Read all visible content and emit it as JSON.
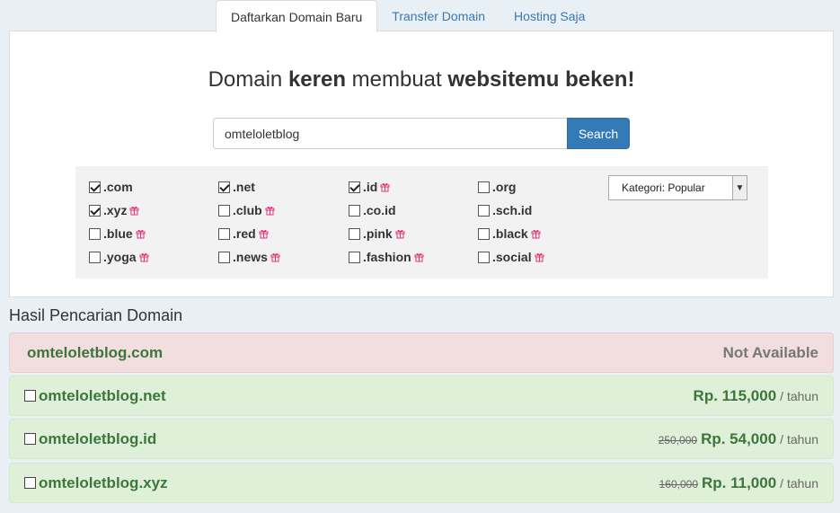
{
  "tabs": [
    {
      "label": "Daftarkan Domain Baru",
      "active": true
    },
    {
      "label": "Transfer Domain",
      "active": false
    },
    {
      "label": "Hosting Saja",
      "active": false
    }
  ],
  "headline": {
    "part1": "Domain ",
    "bold1": "keren",
    "part2": " membuat ",
    "bold2": "websitemu beken!"
  },
  "search": {
    "value": "omteloletblog",
    "button_label": "Search"
  },
  "tlds": [
    {
      "name": ".com",
      "checked": true,
      "gift": false
    },
    {
      "name": ".net",
      "checked": true,
      "gift": false
    },
    {
      "name": ".id",
      "checked": true,
      "gift": true
    },
    {
      "name": ".org",
      "checked": false,
      "gift": false
    },
    {
      "name": ".xyz",
      "checked": true,
      "gift": true
    },
    {
      "name": ".club",
      "checked": false,
      "gift": true
    },
    {
      "name": ".co.id",
      "checked": false,
      "gift": false
    },
    {
      "name": ".sch.id",
      "checked": false,
      "gift": false
    },
    {
      "name": ".blue",
      "checked": false,
      "gift": true
    },
    {
      "name": ".red",
      "checked": false,
      "gift": true
    },
    {
      "name": ".pink",
      "checked": false,
      "gift": true
    },
    {
      "name": ".black",
      "checked": false,
      "gift": true
    },
    {
      "name": ".yoga",
      "checked": false,
      "gift": true
    },
    {
      "name": ".news",
      "checked": false,
      "gift": true
    },
    {
      "name": ".fashion",
      "checked": false,
      "gift": true
    },
    {
      "name": ".social",
      "checked": false,
      "gift": true
    }
  ],
  "kategori": {
    "selected": "Kategori: Popular"
  },
  "results_title": "Hasil Pencarian Domain",
  "results": [
    {
      "domain": "omteloletblog.com",
      "available": false,
      "status": "Not Available"
    },
    {
      "domain": "omteloletblog.net",
      "available": true,
      "old_price": "",
      "price": "Rp. 115,000",
      "per": "/ tahun"
    },
    {
      "domain": "omteloletblog.id",
      "available": true,
      "old_price": "250,000",
      "price": "Rp. 54,000",
      "per": "/ tahun"
    },
    {
      "domain": "omteloletblog.xyz",
      "available": true,
      "old_price": "160,000",
      "price": "Rp. 11,000",
      "per": "/ tahun"
    }
  ],
  "icons": {
    "gift": "gift-icon",
    "checkbox": "checkbox-icon",
    "dropdown": "chevron-down-icon"
  },
  "colors": {
    "accent": "#337ab7",
    "unavailable_bg": "#f2dede",
    "available_bg": "#dff0d8",
    "available_text": "#3c763d",
    "gift": "#e0347a"
  }
}
